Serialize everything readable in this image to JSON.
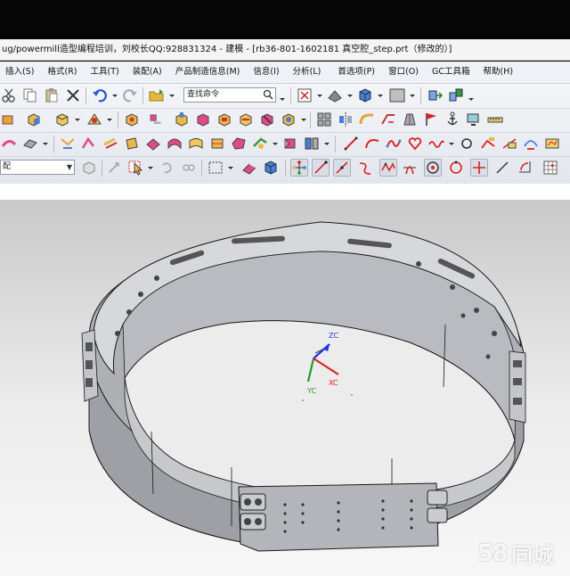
{
  "window": {
    "title": "ug/powermill造型编程培训，刘校长QQ:928831324 - 建模 - [rb36-801-1602181 真空腔_step.prt（修改的）]"
  },
  "menu": {
    "items": [
      "插入(S)",
      "格式(R)",
      "工具(T)",
      "装配(A)",
      "产品制造信息(M)",
      "信息(I)",
      "分析(L)",
      "首选项(P)",
      "窗口(O)",
      "GC工具箱",
      "帮助(H)"
    ]
  },
  "toolbar": {
    "search_placeholder": "查找命令",
    "assembly_combo": "配"
  },
  "view": {
    "triad": {
      "z": "ZC",
      "y": "YC",
      "x": "XC"
    },
    "colors": {
      "z": "#2233dd",
      "y": "#1f9a2e",
      "x": "#dd2222",
      "part": "#b3b5ba",
      "edge": "#1a1a1a"
    }
  },
  "watermark": {
    "number": "58",
    "text": "同城"
  }
}
